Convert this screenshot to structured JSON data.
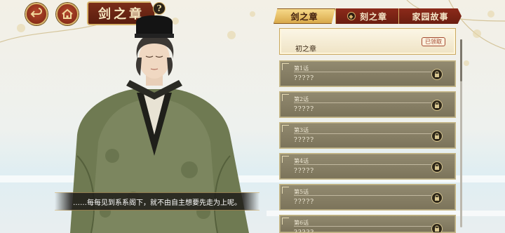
{
  "header": {
    "title": "剑之章",
    "back_icon": "back-arrow-icon",
    "home_icon": "home-icon",
    "help_label": "?"
  },
  "tabs": [
    {
      "label": "剑之章",
      "active": true
    },
    {
      "label": "刻之章",
      "active": false,
      "icon": "sword-guard-icon"
    },
    {
      "label": "家园故事",
      "active": false
    }
  ],
  "chapter": {
    "title": "初之章",
    "badge": "已领取"
  },
  "episodes": [
    {
      "title": "第1话",
      "subtitle": "?????",
      "locked": true
    },
    {
      "title": "第2话",
      "subtitle": "?????",
      "locked": true
    },
    {
      "title": "第3话",
      "subtitle": "?????",
      "locked": true
    },
    {
      "title": "第4话",
      "subtitle": "?????",
      "locked": true
    },
    {
      "title": "第5话",
      "subtitle": "?????",
      "locked": true
    },
    {
      "title": "第6话",
      "subtitle": "?????",
      "locked": true
    }
  ],
  "dialogue": {
    "text": "……每每见到系系阁下，就不由自主想要先走为上呢。"
  },
  "colors": {
    "accent_red": "#7a2d19",
    "gold": "#d7b36a",
    "episode_bg": "#857d63"
  }
}
